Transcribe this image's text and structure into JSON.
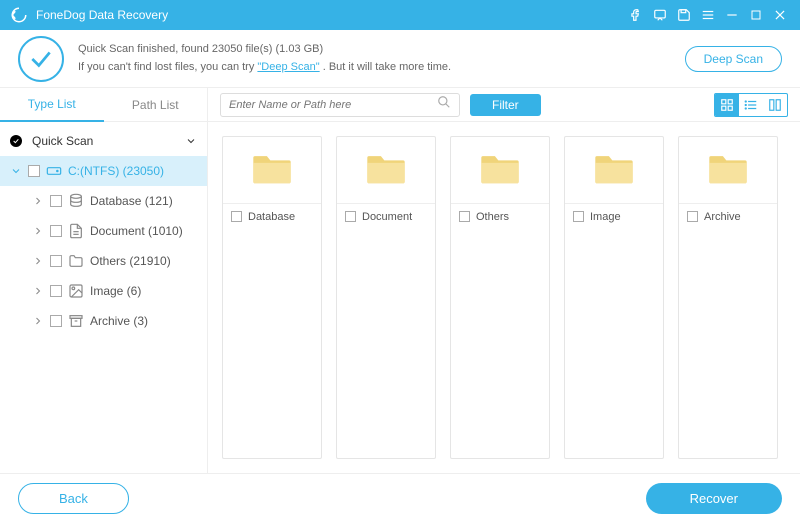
{
  "app": {
    "title": "FoneDog Data Recovery"
  },
  "status": {
    "line1": "Quick Scan finished, found 23050 file(s) (1.03 GB)",
    "line2_a": "If you can't find lost files, you can try ",
    "line2_link": "\"Deep Scan\"",
    "line2_b": ". But it will take more time.",
    "deep_scan_btn": "Deep Scan"
  },
  "sidebar": {
    "tabs": {
      "type_list": "Type List",
      "path_list": "Path List"
    },
    "root": "Quick Scan",
    "drive": "C:(NTFS) (23050)",
    "children": [
      {
        "label": "Database (121)",
        "icon": "database-icon"
      },
      {
        "label": "Document (1010)",
        "icon": "document-icon"
      },
      {
        "label": "Others (21910)",
        "icon": "folder-icon"
      },
      {
        "label": "Image (6)",
        "icon": "image-icon"
      },
      {
        "label": "Archive (3)",
        "icon": "archive-icon"
      }
    ]
  },
  "toolbar": {
    "search_placeholder": "Enter Name or Path here",
    "filter": "Filter"
  },
  "grid": {
    "items": [
      {
        "label": "Database"
      },
      {
        "label": "Document"
      },
      {
        "label": "Others"
      },
      {
        "label": "Image"
      },
      {
        "label": "Archive"
      }
    ]
  },
  "footer": {
    "back": "Back",
    "recover": "Recover"
  },
  "colors": {
    "accent": "#36b2e6"
  }
}
